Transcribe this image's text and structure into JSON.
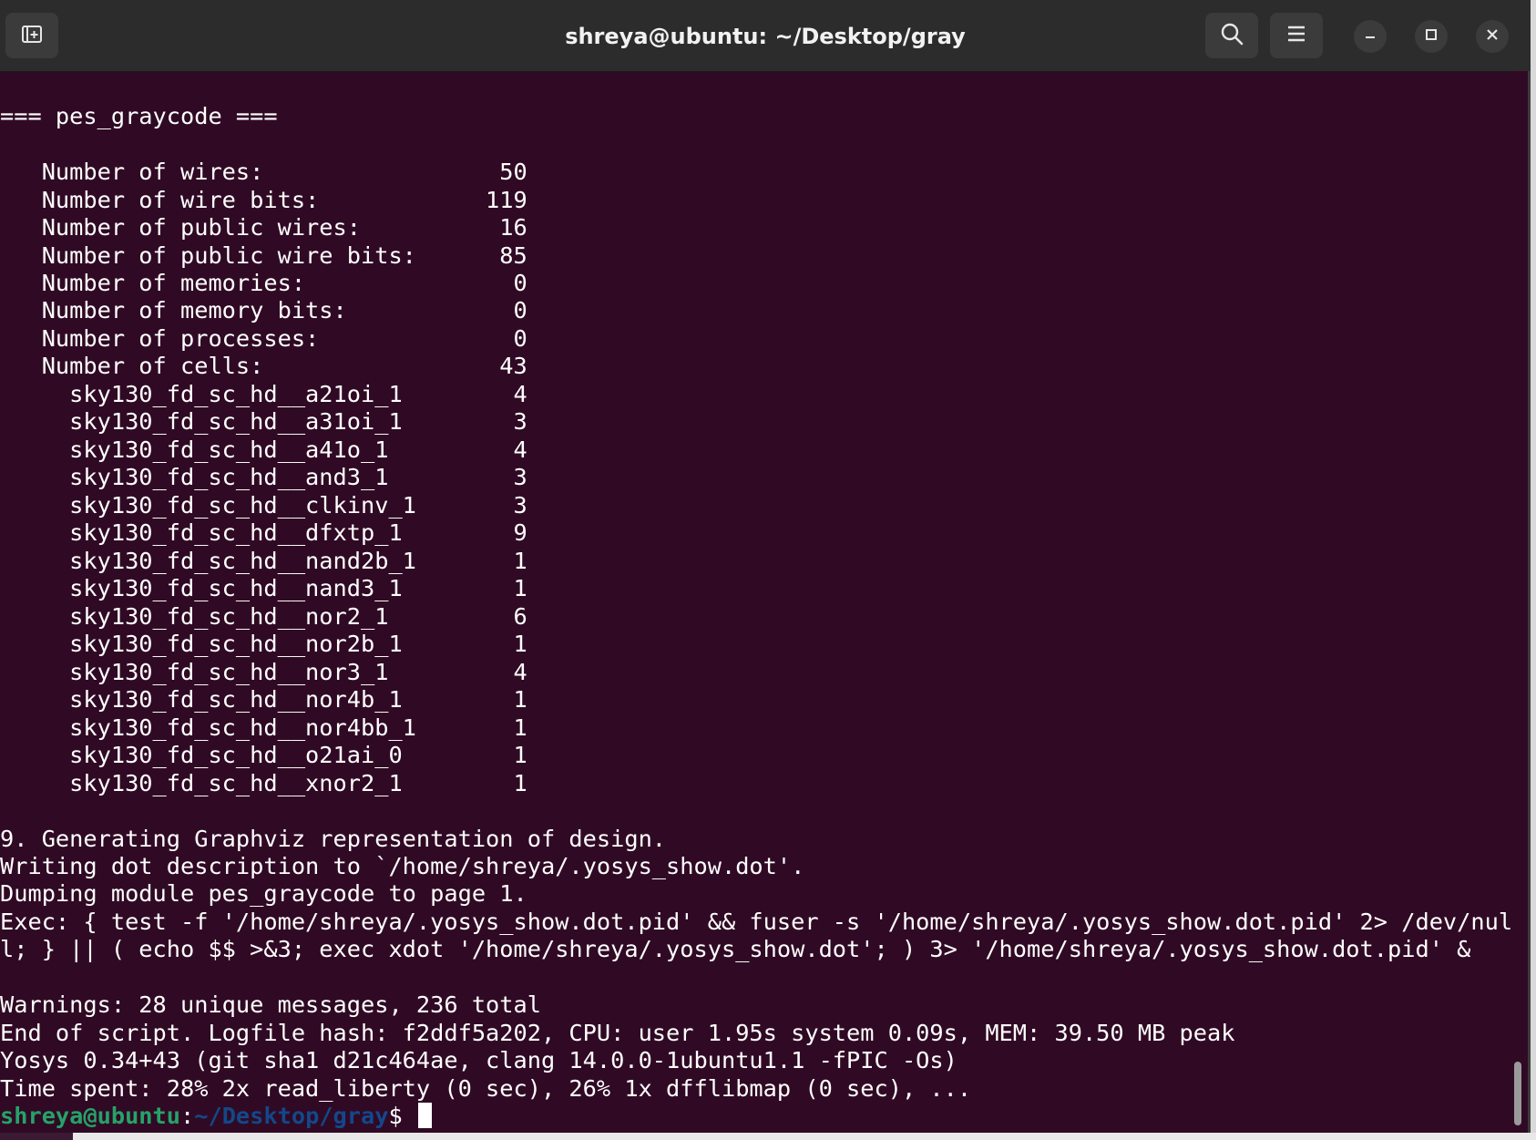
{
  "window": {
    "title": "shreya@ubuntu: ~/Desktop/gray",
    "icons": {
      "new_tab": "new-tab-icon",
      "search": "search-icon",
      "menu": "hamburger-menu-icon",
      "minimize": "minimize-icon",
      "maximize": "maximize-icon",
      "close": "close-icon"
    }
  },
  "terminal": {
    "lines": [
      "",
      "=== pes_graycode ===",
      "",
      "   Number of wires:                 50",
      "   Number of wire bits:            119",
      "   Number of public wires:          16",
      "   Number of public wire bits:      85",
      "   Number of memories:               0",
      "   Number of memory bits:            0",
      "   Number of processes:              0",
      "   Number of cells:                 43",
      "     sky130_fd_sc_hd__a21oi_1        4",
      "     sky130_fd_sc_hd__a31oi_1        3",
      "     sky130_fd_sc_hd__a41o_1         4",
      "     sky130_fd_sc_hd__and3_1         3",
      "     sky130_fd_sc_hd__clkinv_1       3",
      "     sky130_fd_sc_hd__dfxtp_1        9",
      "     sky130_fd_sc_hd__nand2b_1       1",
      "     sky130_fd_sc_hd__nand3_1        1",
      "     sky130_fd_sc_hd__nor2_1         6",
      "     sky130_fd_sc_hd__nor2b_1        1",
      "     sky130_fd_sc_hd__nor3_1         4",
      "     sky130_fd_sc_hd__nor4b_1        1",
      "     sky130_fd_sc_hd__nor4bb_1       1",
      "     sky130_fd_sc_hd__o21ai_0        1",
      "     sky130_fd_sc_hd__xnor2_1        1",
      "",
      "9. Generating Graphviz representation of design.",
      "Writing dot description to `/home/shreya/.yosys_show.dot'.",
      "Dumping module pes_graycode to page 1.",
      "Exec: { test -f '/home/shreya/.yosys_show.dot.pid' && fuser -s '/home/shreya/.yosys_show.dot.pid' 2> /dev/nul",
      "l; } || ( echo $$ >&3; exec xdot '/home/shreya/.yosys_show.dot'; ) 3> '/home/shreya/.yosys_show.dot.pid' &",
      "",
      "Warnings: 28 unique messages, 236 total",
      "End of script. Logfile hash: f2ddf5a202, CPU: user 1.95s system 0.09s, MEM: 39.50 MB peak",
      "Yosys 0.34+43 (git sha1 d21c464ae, clang 14.0.0-1ubuntu1.1 -fPIC -Os)",
      "Time spent: 28% 2x read_liberty (0 sec), 26% 1x dfflibmap (0 sec), ..."
    ],
    "prompt": {
      "user_host": "shreya@ubuntu",
      "separator": ":",
      "path": "~/Desktop/gray",
      "symbol": "$ "
    }
  },
  "colors": {
    "background": "#300a24",
    "titlebar": "#2c2c2c",
    "text": "#ffffff",
    "prompt_user": "#26a269",
    "prompt_path": "#12488b"
  }
}
